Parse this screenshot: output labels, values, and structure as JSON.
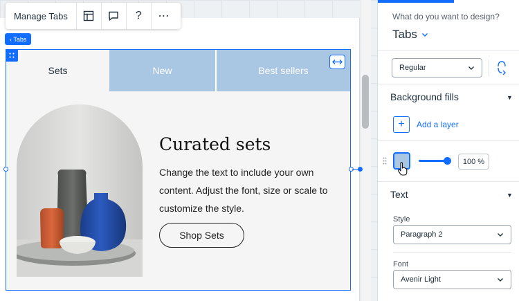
{
  "toolbar": {
    "manage_label": "Manage Tabs",
    "icons": [
      "layout-icon",
      "comment-icon",
      "help-icon",
      "more-icon"
    ],
    "help_glyph": "?",
    "more_glyph": "⋯"
  },
  "element_tag": {
    "label": "‹ Tabs"
  },
  "tabs": [
    {
      "label": "Sets",
      "selected": true
    },
    {
      "label": "New",
      "selected": false
    },
    {
      "label": "Best sellers",
      "selected": false
    }
  ],
  "content": {
    "heading": "Curated sets",
    "body": "Change the text to include your own content. Adjust the font, size or scale to customize the style.",
    "button_label": "Shop Sets"
  },
  "panel": {
    "question": "What do you want to design?",
    "component": "Tabs",
    "state_value": "Regular",
    "background_title": "Background fills",
    "add_layer_label": "Add a layer",
    "opacity": "100 %",
    "opacity_fraction": 1.0,
    "text_title": "Text",
    "style_label": "Style",
    "style_value": "Paragraph 2",
    "font_label": "Font",
    "font_value": "Avenir Light"
  },
  "colors": {
    "accent": "#116dff",
    "tab_inactive": "#a9c6e2",
    "tab_active": "#f5f5f5"
  }
}
